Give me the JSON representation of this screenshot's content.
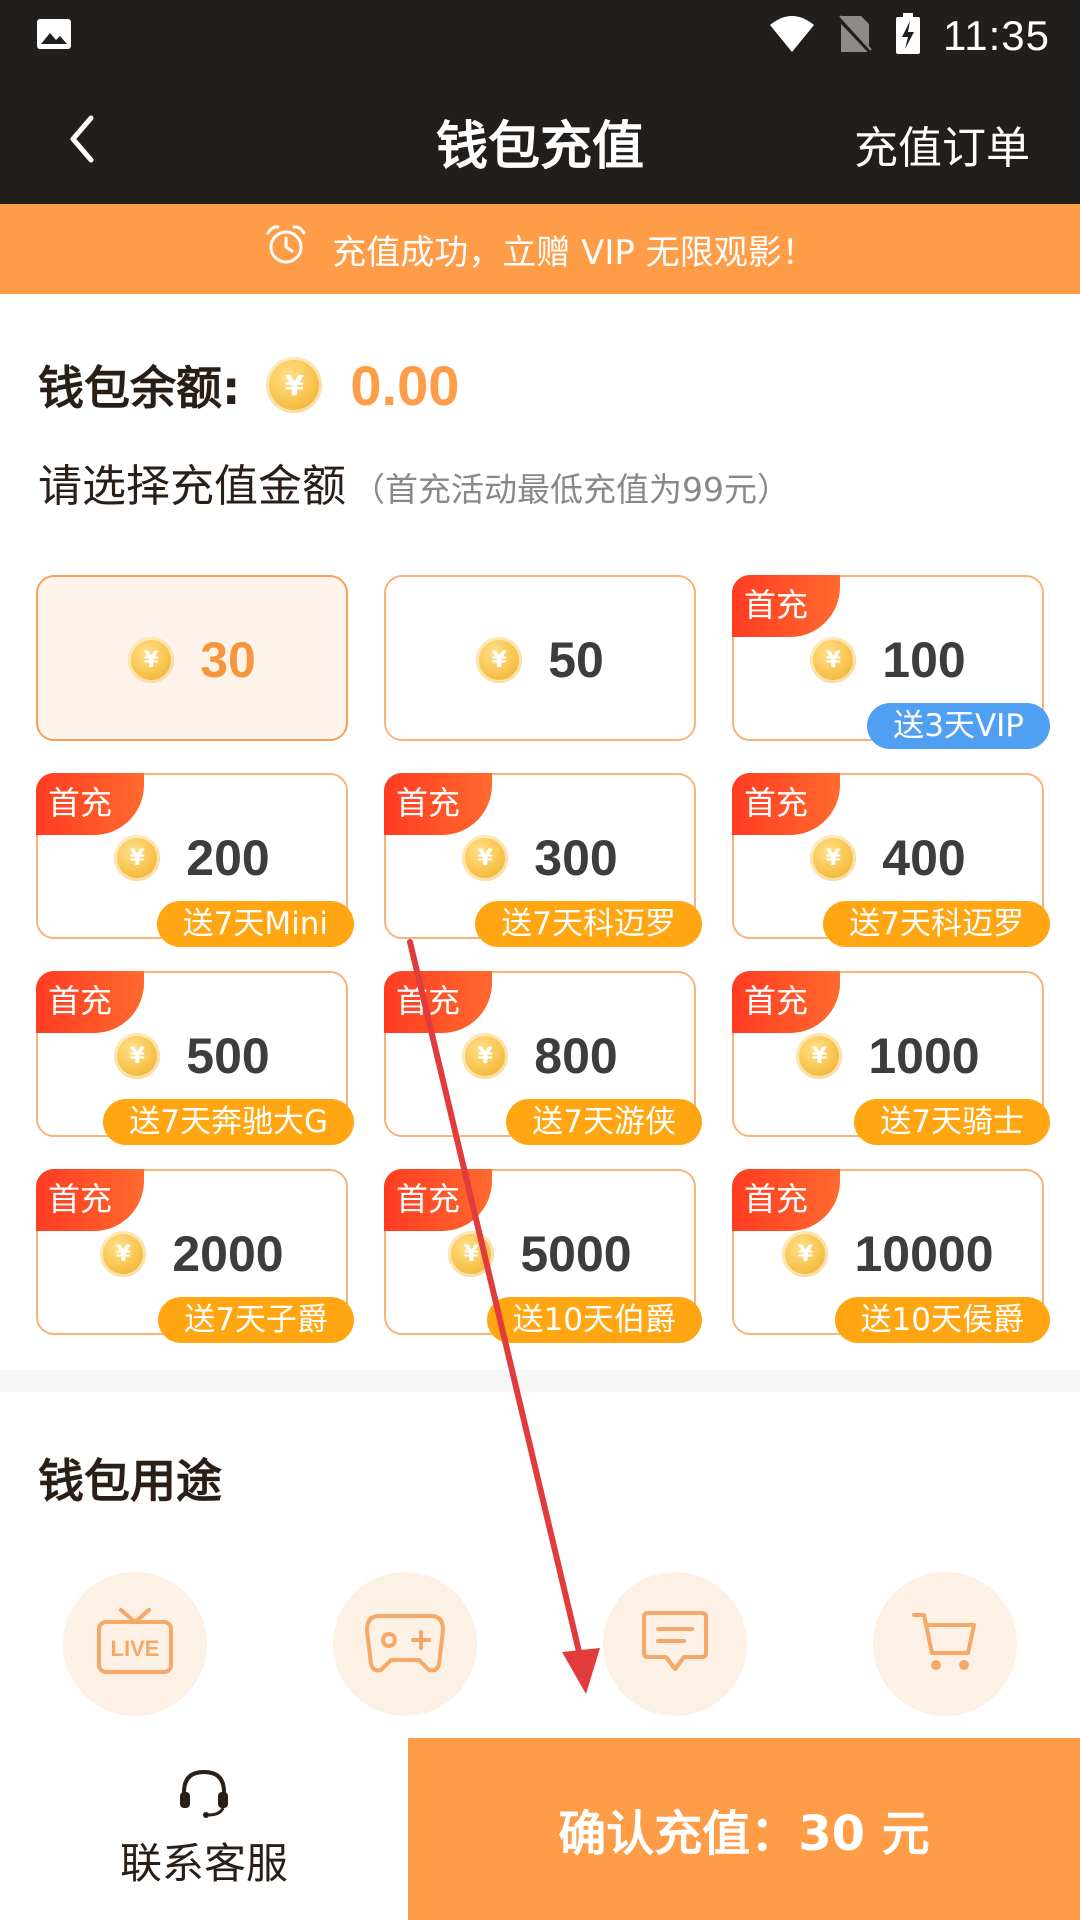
{
  "status_bar": {
    "time": "11:35",
    "icons": [
      "image-icon",
      "wifi-icon",
      "no-sim-icon",
      "battery-charging-icon"
    ]
  },
  "header": {
    "title": "钱包充值",
    "back_icon": "chevron-left-icon",
    "order_link": "充值订单"
  },
  "banner": {
    "icon": "alarm-clock-icon",
    "text": "充值成功，立赠 VIP 无限观影！"
  },
  "balance": {
    "label": "钱包余额:",
    "coin_symbol": "¥",
    "value": "0.00"
  },
  "select": {
    "title": "请选择充值金额",
    "note": "（首充活动最低充值为99元）"
  },
  "packages": [
    {
      "amount": "30",
      "first_tag": "",
      "gift": "",
      "selected": true
    },
    {
      "amount": "50",
      "first_tag": "",
      "gift": ""
    },
    {
      "amount": "100",
      "first_tag": "首充",
      "gift": "送3天VIP",
      "gift_color": "#4f9ff3"
    },
    {
      "amount": "200",
      "first_tag": "首充",
      "gift": "送7天Mini"
    },
    {
      "amount": "300",
      "first_tag": "首充",
      "gift": "送7天科迈罗"
    },
    {
      "amount": "400",
      "first_tag": "首充",
      "gift": "送7天科迈罗"
    },
    {
      "amount": "500",
      "first_tag": "首充",
      "gift": "送7天奔驰大G"
    },
    {
      "amount": "800",
      "first_tag": "首充",
      "gift": "送7天游侠"
    },
    {
      "amount": "1000",
      "first_tag": "首充",
      "gift": "送7天骑士"
    },
    {
      "amount": "2000",
      "first_tag": "首充",
      "gift": "送7天子爵"
    },
    {
      "amount": "5000",
      "first_tag": "首充",
      "gift": "送10天伯爵"
    },
    {
      "amount": "10000",
      "first_tag": "首充",
      "gift": "送10天侯爵"
    }
  ],
  "usage": {
    "title": "钱包用途",
    "items": [
      {
        "icon": "live-tv-icon",
        "label": ""
      },
      {
        "icon": "gamepad-icon",
        "label": ""
      },
      {
        "icon": "chat-bubble-icon",
        "label": ""
      },
      {
        "icon": "shopping-cart-icon",
        "label": ""
      }
    ]
  },
  "bottom": {
    "service_icon": "headset-icon",
    "service_label": "联系客服",
    "confirm_label": "确认充值：30 元"
  },
  "colors": {
    "header_bg": "#221e1b",
    "accent_orange": "#fe9c47",
    "first_tag_red": "#ff3b22",
    "gift_orange": "#ffa612",
    "gift_blue": "#4f9ff3",
    "annotation_arrow": "#e23b3b"
  }
}
